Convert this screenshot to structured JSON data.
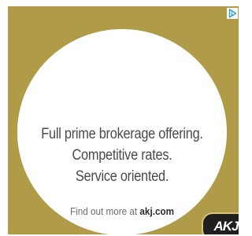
{
  "ad": {
    "headline": [
      "Full prime brokerage offering.",
      "Competitive rates.",
      "Service oriented."
    ],
    "cta_prefix": "Find out more at",
    "cta_domain": "akj.com",
    "logo_text": "AKJ",
    "adchoices_icon": "adchoices-triangle-icon",
    "colors": {
      "background": "#b09b48",
      "circle": "#ffffff",
      "text": "#4a4a4a",
      "logo_bg": "#1f1f1f",
      "adchoices": "#2a9fd6"
    }
  }
}
